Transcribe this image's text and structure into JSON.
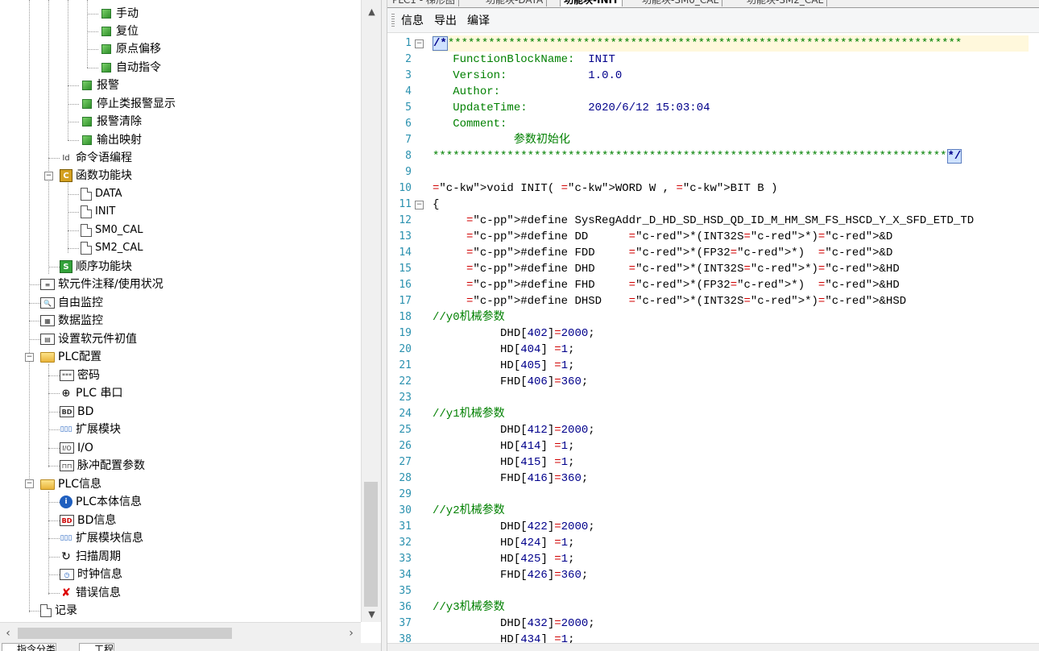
{
  "tree": {
    "items": [
      {
        "label": "手动"
      },
      {
        "label": "复位"
      },
      {
        "label": "原点偏移"
      },
      {
        "label": "自动指令"
      },
      {
        "label": "报警"
      },
      {
        "label": "停止类报警显示"
      },
      {
        "label": "报警清除"
      },
      {
        "label": "输出映射"
      },
      {
        "label": "命令语编程"
      },
      {
        "label": "函数功能块"
      },
      {
        "label": "DATA"
      },
      {
        "label": "INIT"
      },
      {
        "label": "SM0_CAL"
      },
      {
        "label": "SM2_CAL"
      },
      {
        "label": "顺序功能块"
      },
      {
        "label": "软元件注释/使用状况"
      },
      {
        "label": "自由监控"
      },
      {
        "label": "数据监控"
      },
      {
        "label": "设置软元件初值"
      },
      {
        "label": "PLC配置"
      },
      {
        "label": "密码"
      },
      {
        "label": "PLC 串口"
      },
      {
        "label": "BD"
      },
      {
        "label": "扩展模块"
      },
      {
        "label": "I/O"
      },
      {
        "label": "脉冲配置参数"
      },
      {
        "label": "PLC信息"
      },
      {
        "label": "PLC本体信息"
      },
      {
        "label": "BD信息"
      },
      {
        "label": "扩展模块信息"
      },
      {
        "label": "扫描周期"
      },
      {
        "label": "时钟信息"
      },
      {
        "label": "错误信息"
      },
      {
        "label": "记录"
      }
    ],
    "bottom_tabs": [
      "指令分类",
      "工程"
    ]
  },
  "editor": {
    "tabs": [
      "PLC1 - 梯形图",
      "功能块-DATA",
      "功能块-INIT",
      "功能块-SM0_CAL",
      "功能块-SM2_CAL"
    ],
    "active_tab": "功能块-INIT",
    "toolbar": {
      "info": "信息",
      "export": "导出",
      "compile": "编译"
    },
    "lines": [
      "/*****************************************************************************",
      "   FunctionBlockName:  INIT",
      "   Version:            1.0.0",
      "   Author:",
      "   UpdateTime:         2020/6/12 15:03:04",
      "   Comment:",
      "            参数初始化",
      "*****************************************************************************/",
      "",
      "void INIT( WORD W , BIT B )",
      "{",
      "     #define SysRegAddr_D_HD_SD_HSD_QD_ID_M_HM_SM_FS_HSCD_Y_X_SFD_ETD_TD",
      "     #define DD      *(INT32S*)&D",
      "     #define FDD     *(FP32*)  &D",
      "     #define DHD     *(INT32S*)&HD",
      "     #define FHD     *(FP32*)  &HD",
      "     #define DHSD    *(INT32S*)&HSD",
      "//y0机械参数",
      "          DHD[402]=2000;",
      "          HD[404] =1;",
      "          HD[405] =1;",
      "          FHD[406]=360;",
      "",
      "//y1机械参数",
      "          DHD[412]=2000;",
      "          HD[414] =1;",
      "          HD[415] =1;",
      "          FHD[416]=360;",
      "",
      "//y2机械参数",
      "          DHD[422]=2000;",
      "          HD[424] =1;",
      "          HD[425] =1;",
      "          FHD[426]=360;",
      "",
      "//y3机械参数",
      "          DHD[432]=2000;",
      "          HD[434] =1;"
    ]
  }
}
